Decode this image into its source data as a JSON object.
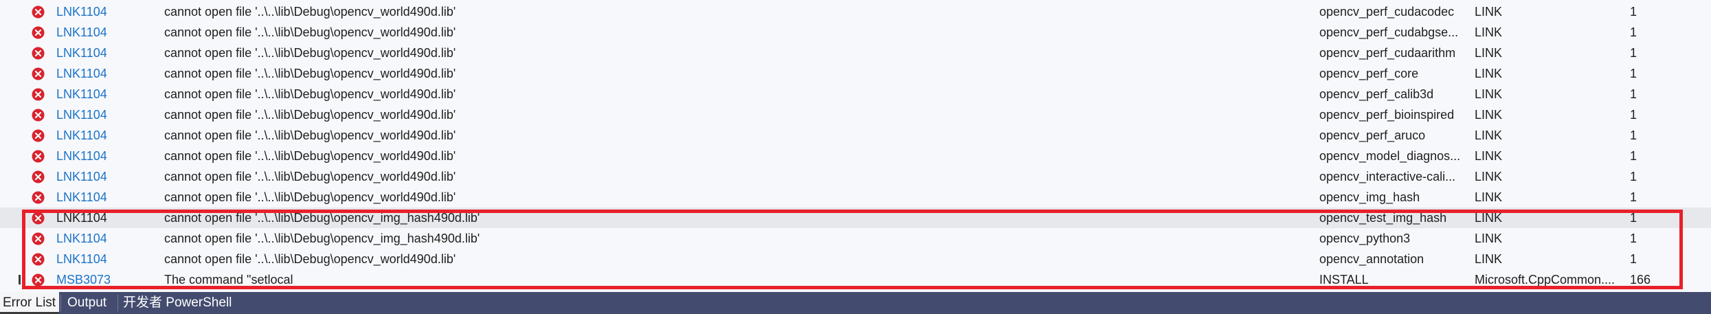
{
  "error_list": {
    "rows": [
      {
        "code": "LNK1104",
        "description": "cannot open file '..\\..\\lib\\Debug\\opencv_world490d.lib'",
        "project": "opencv_perf_cudacodec",
        "file": "LINK",
        "line": "1"
      },
      {
        "code": "LNK1104",
        "description": "cannot open file '..\\..\\lib\\Debug\\opencv_world490d.lib'",
        "project": "opencv_perf_cudabgse...",
        "file": "LINK",
        "line": "1"
      },
      {
        "code": "LNK1104",
        "description": "cannot open file '..\\..\\lib\\Debug\\opencv_world490d.lib'",
        "project": "opencv_perf_cudaarithm",
        "file": "LINK",
        "line": "1"
      },
      {
        "code": "LNK1104",
        "description": "cannot open file '..\\..\\lib\\Debug\\opencv_world490d.lib'",
        "project": "opencv_perf_core",
        "file": "LINK",
        "line": "1"
      },
      {
        "code": "LNK1104",
        "description": "cannot open file '..\\..\\lib\\Debug\\opencv_world490d.lib'",
        "project": "opencv_perf_calib3d",
        "file": "LINK",
        "line": "1"
      },
      {
        "code": "LNK1104",
        "description": "cannot open file '..\\..\\lib\\Debug\\opencv_world490d.lib'",
        "project": "opencv_perf_bioinspired",
        "file": "LINK",
        "line": "1"
      },
      {
        "code": "LNK1104",
        "description": "cannot open file '..\\..\\lib\\Debug\\opencv_world490d.lib'",
        "project": "opencv_perf_aruco",
        "file": "LINK",
        "line": "1"
      },
      {
        "code": "LNK1104",
        "description": "cannot open file '..\\..\\lib\\Debug\\opencv_world490d.lib'",
        "project": "opencv_model_diagnos...",
        "file": "LINK",
        "line": "1"
      },
      {
        "code": "LNK1104",
        "description": "cannot open file '..\\..\\lib\\Debug\\opencv_world490d.lib'",
        "project": "opencv_interactive-cali...",
        "file": "LINK",
        "line": "1"
      },
      {
        "code": "LNK1104",
        "description": "cannot open file '..\\..\\lib\\Debug\\opencv_world490d.lib'",
        "project": "opencv_img_hash",
        "file": "LINK",
        "line": "1"
      },
      {
        "code": "LNK1104",
        "description": "cannot open file '..\\..\\lib\\Debug\\opencv_img_hash490d.lib'",
        "project": "opencv_test_img_hash",
        "file": "LINK",
        "line": "1"
      },
      {
        "code": "LNK1104",
        "description": "cannot open file '..\\..\\lib\\Debug\\opencv_img_hash490d.lib'",
        "project": "opencv_python3",
        "file": "LINK",
        "line": "1"
      },
      {
        "code": "LNK1104",
        "description": "cannot open file '..\\..\\lib\\Debug\\opencv_world490d.lib'",
        "project": "opencv_annotation",
        "file": "LINK",
        "line": "1"
      },
      {
        "code": "MSB3073",
        "description": "The command \"setlocal",
        "project": "INSTALL",
        "file": "Microsoft.CppCommon....",
        "line": "166"
      }
    ]
  },
  "tabs": [
    "Error List",
    "Output",
    "开发者 PowerShell"
  ],
  "colors": {
    "error_icon": "#d9232e",
    "code_link": "#1a73c9",
    "highlight_border": "#e8202a",
    "tabbar_bg": "#434c6e"
  }
}
